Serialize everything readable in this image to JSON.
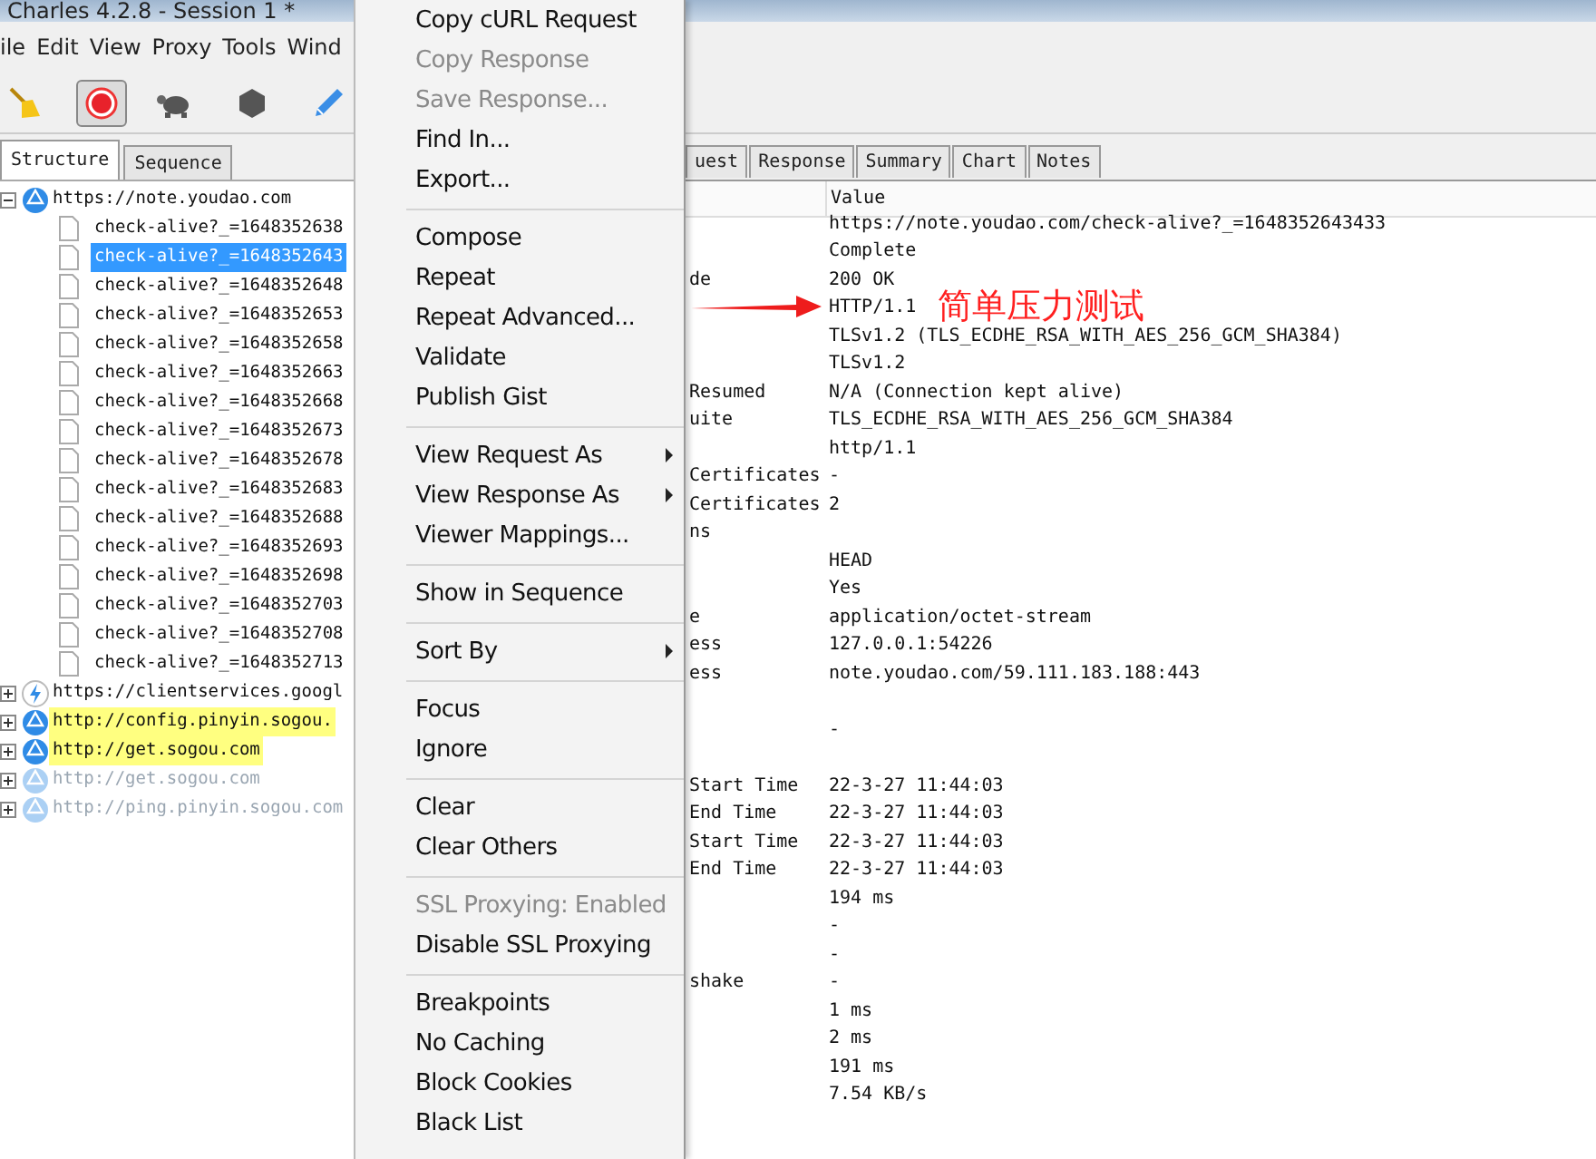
{
  "window": {
    "title": "Charles 4.2.8 - Session 1 *"
  },
  "menubar": [
    "ile",
    "Edit",
    "View",
    "Proxy",
    "Tools",
    "Wind"
  ],
  "toolbar": [
    {
      "kind": "broom",
      "selected": false
    },
    {
      "kind": "record",
      "selected": true
    },
    {
      "kind": "turtle",
      "selected": false
    },
    {
      "kind": "stop",
      "selected": false
    },
    {
      "kind": "pen",
      "selected": false
    }
  ],
  "view_tabs": [
    {
      "label": "Structure",
      "selected": true
    },
    {
      "label": "Sequence",
      "selected": false
    }
  ],
  "tree": [
    {
      "label": "https://note.youdao.com",
      "kind": "globe",
      "expanded": true,
      "highlighted": false,
      "faded": false,
      "children": [
        {
          "label": "check-alive?_=1648352638",
          "selected": false
        },
        {
          "label": "check-alive?_=1648352643",
          "selected": true
        },
        {
          "label": "check-alive?_=1648352648",
          "selected": false
        },
        {
          "label": "check-alive?_=1648352653",
          "selected": false
        },
        {
          "label": "check-alive?_=1648352658",
          "selected": false
        },
        {
          "label": "check-alive?_=1648352663",
          "selected": false
        },
        {
          "label": "check-alive?_=1648352668",
          "selected": false
        },
        {
          "label": "check-alive?_=1648352673",
          "selected": false
        },
        {
          "label": "check-alive?_=1648352678",
          "selected": false
        },
        {
          "label": "check-alive?_=1648352683",
          "selected": false
        },
        {
          "label": "check-alive?_=1648352688",
          "selected": false
        },
        {
          "label": "check-alive?_=1648352693",
          "selected": false
        },
        {
          "label": "check-alive?_=1648352698",
          "selected": false
        },
        {
          "label": "check-alive?_=1648352703",
          "selected": false
        },
        {
          "label": "check-alive?_=1648352708",
          "selected": false
        },
        {
          "label": "check-alive?_=1648352713",
          "selected": false
        }
      ]
    },
    {
      "label": "https://clientservices.googl",
      "kind": "bolt",
      "expanded": false,
      "highlighted": false,
      "faded": false
    },
    {
      "label": "http://config.pinyin.sogou.",
      "kind": "globe",
      "expanded": false,
      "highlighted": true,
      "faded": false
    },
    {
      "label": "http://get.sogou.com",
      "kind": "globe",
      "expanded": false,
      "highlighted": true,
      "faded": false
    },
    {
      "label": "http://get.sogou.com",
      "kind": "globe",
      "expanded": false,
      "highlighted": false,
      "faded": true
    },
    {
      "label": "http://ping.pinyin.sogou.com",
      "kind": "globe",
      "expanded": false,
      "highlighted": false,
      "faded": true
    }
  ],
  "context_menu": {
    "groups": [
      [
        {
          "label": "Copy cURL Request",
          "disabled": false,
          "submenu": false
        },
        {
          "label": "Copy Response",
          "disabled": true,
          "submenu": false
        },
        {
          "label": "Save Response...",
          "disabled": true,
          "submenu": false
        },
        {
          "label": "Find In...",
          "disabled": false,
          "submenu": false
        },
        {
          "label": "Export...",
          "disabled": false,
          "submenu": false
        }
      ],
      [
        {
          "label": "Compose",
          "disabled": false,
          "submenu": false
        },
        {
          "label": "Repeat",
          "disabled": false,
          "submenu": false
        },
        {
          "label": "Repeat Advanced...",
          "disabled": false,
          "submenu": false
        },
        {
          "label": "Validate",
          "disabled": false,
          "submenu": false
        },
        {
          "label": "Publish Gist",
          "disabled": false,
          "submenu": false
        }
      ],
      [
        {
          "label": "View Request As",
          "disabled": false,
          "submenu": true
        },
        {
          "label": "View Response As",
          "disabled": false,
          "submenu": true
        },
        {
          "label": "Viewer Mappings...",
          "disabled": false,
          "submenu": false
        }
      ],
      [
        {
          "label": "Show in Sequence",
          "disabled": false,
          "submenu": false
        }
      ],
      [
        {
          "label": "Sort By",
          "disabled": false,
          "submenu": true
        }
      ],
      [
        {
          "label": "Focus",
          "disabled": false,
          "submenu": false
        },
        {
          "label": "Ignore",
          "disabled": false,
          "submenu": false
        }
      ],
      [
        {
          "label": "Clear",
          "disabled": false,
          "submenu": false
        },
        {
          "label": "Clear Others",
          "disabled": false,
          "submenu": false
        }
      ],
      [
        {
          "label": "SSL Proxying: Enabled",
          "disabled": true,
          "submenu": false
        },
        {
          "label": "Disable SSL Proxying",
          "disabled": false,
          "submenu": false
        }
      ],
      [
        {
          "label": "Breakpoints",
          "disabled": false,
          "submenu": false
        },
        {
          "label": "No Caching",
          "disabled": false,
          "submenu": false
        },
        {
          "label": "Block Cookies",
          "disabled": false,
          "submenu": false
        },
        {
          "label": "Black List",
          "disabled": false,
          "submenu": false
        }
      ]
    ]
  },
  "detail_tabs": [
    {
      "label": "uest",
      "selected": false
    },
    {
      "label": "Response",
      "selected": false
    },
    {
      "label": "Summary",
      "selected": false
    },
    {
      "label": "Chart",
      "selected": false
    },
    {
      "label": "Notes",
      "selected": false
    }
  ],
  "table": {
    "columns": [
      "Value"
    ],
    "rows": [
      {
        "name": "",
        "value": "https://note.youdao.com/check-alive?_=1648352643433"
      },
      {
        "name": "",
        "value": "Complete"
      },
      {
        "name": "de",
        "value": "200 OK"
      },
      {
        "name": "",
        "value": "HTTP/1.1"
      },
      {
        "name": "",
        "value": "TLSv1.2 (TLS_ECDHE_RSA_WITH_AES_256_GCM_SHA384)"
      },
      {
        "name": "",
        "value": "TLSv1.2"
      },
      {
        "name": "Resumed",
        "value": "N/A (Connection kept alive)"
      },
      {
        "name": "uite",
        "value": "TLS_ECDHE_RSA_WITH_AES_256_GCM_SHA384"
      },
      {
        "name": "",
        "value": "http/1.1"
      },
      {
        "name": "Certificates",
        "value": "-"
      },
      {
        "name": "Certificates",
        "value": "2"
      },
      {
        "name": "ns",
        "value": ""
      },
      {
        "name": "",
        "value": "HEAD"
      },
      {
        "name": "",
        "value": "Yes"
      },
      {
        "name": "e",
        "value": "application/octet-stream"
      },
      {
        "name": "ess",
        "value": "127.0.0.1:54226"
      },
      {
        "name": "ess",
        "value": "note.youdao.com/59.111.183.188:443"
      },
      {
        "name": "",
        "value": ""
      },
      {
        "name": "",
        "value": "-"
      },
      {
        "name": "",
        "value": ""
      },
      {
        "name": "Start Time",
        "value": "22-3-27 11:44:03"
      },
      {
        "name": "End Time",
        "value": "22-3-27 11:44:03"
      },
      {
        "name": "Start Time",
        "value": "22-3-27 11:44:03"
      },
      {
        "name": "End Time",
        "value": "22-3-27 11:44:03"
      },
      {
        "name": "",
        "value": "194 ms"
      },
      {
        "name": "",
        "value": "-"
      },
      {
        "name": "",
        "value": "-"
      },
      {
        "name": "shake",
        "value": "-"
      },
      {
        "name": "",
        "value": "1 ms"
      },
      {
        "name": "",
        "value": "2 ms"
      },
      {
        "name": "",
        "value": "191 ms"
      },
      {
        "name": "",
        "value": "7.54 KB/s"
      }
    ]
  },
  "annotation": {
    "text": "简单压力测试"
  }
}
